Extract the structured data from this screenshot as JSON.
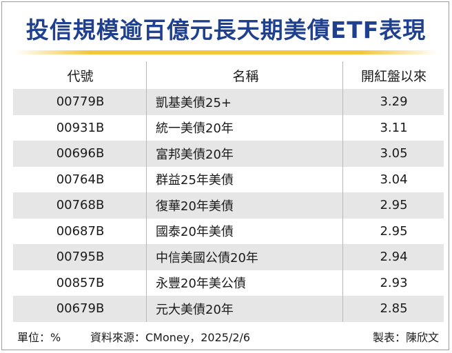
{
  "title": "投信規模逾百億元長天期美債ETF表現",
  "table": {
    "headers": [
      "代號",
      "名稱",
      "開紅盤以來"
    ],
    "rows": [
      {
        "code": "00779B",
        "name": "凱基美債25+",
        "value": "3.29"
      },
      {
        "code": "00931B",
        "name": "統一美債20年",
        "value": "3.11"
      },
      {
        "code": "00696B",
        "name": "富邦美債20年",
        "value": "3.05"
      },
      {
        "code": "00764B",
        "name": "群益25年美債",
        "value": "3.04"
      },
      {
        "code": "00768B",
        "name": "復華20年美債",
        "value": "2.95"
      },
      {
        "code": "00687B",
        "name": "國泰20年美債",
        "value": "2.95"
      },
      {
        "code": "00795B",
        "name": "中信美國公債20年",
        "value": "2.94"
      },
      {
        "code": "00857B",
        "name": "永豐20年美公債",
        "value": "2.93"
      },
      {
        "code": "00679B",
        "name": "元大美債20年",
        "value": "2.85"
      }
    ]
  },
  "footer": {
    "unit": "單位：%",
    "source": "資料來源：CMoney，2025/2/6",
    "maker": "製表：陳欣文"
  },
  "colors": {
    "title": "#1f3f8f",
    "rule": "#f3c63b",
    "row_shade": "#e6e6e6"
  }
}
